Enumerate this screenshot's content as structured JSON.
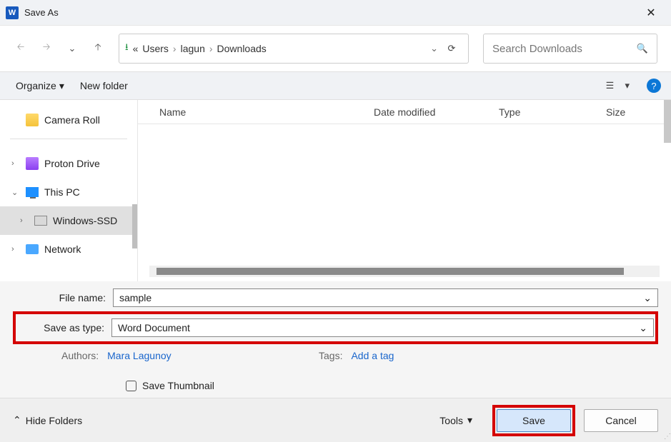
{
  "title": "Save As",
  "crumbs": {
    "a": "«",
    "b": "Users",
    "c": "lagun",
    "d": "Downloads"
  },
  "search_placeholder": "Search Downloads",
  "toolbar": {
    "organize": "Organize",
    "newfolder": "New folder"
  },
  "sidebar": {
    "camera": "Camera Roll",
    "proton": "Proton Drive",
    "thispc": "This PC",
    "winssd": "Windows-SSD",
    "network": "Network"
  },
  "cols": {
    "name": "Name",
    "date": "Date modified",
    "type": "Type",
    "size": "Size"
  },
  "form": {
    "filename_label": "File name:",
    "filename_value": "sample",
    "savetype_label": "Save as type:",
    "savetype_value": "Word Document",
    "authors_label": "Authors:",
    "authors_value": "Mara Lagunoy",
    "tags_label": "Tags:",
    "tags_value": "Add a tag",
    "thumbnail": "Save Thumbnail"
  },
  "footer": {
    "hide": "Hide Folders",
    "tools": "Tools",
    "save": "Save",
    "cancel": "Cancel"
  }
}
